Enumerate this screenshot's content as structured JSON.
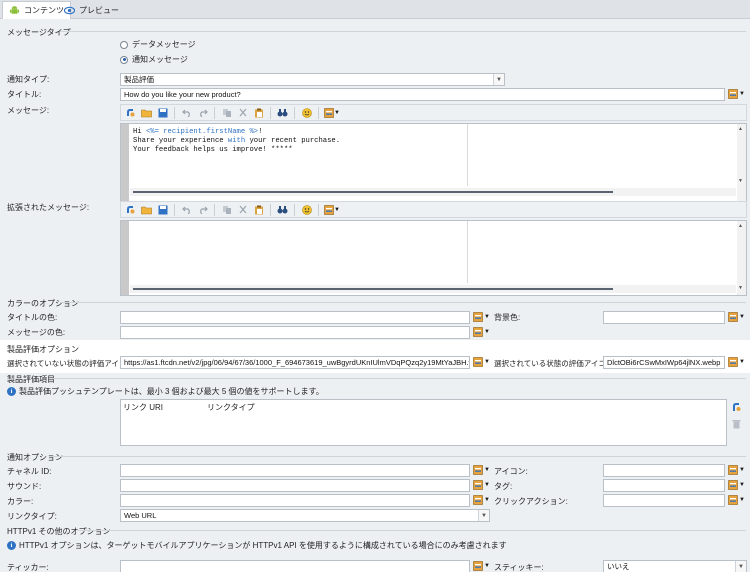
{
  "tabs": [
    {
      "label": "コンテンツ"
    },
    {
      "label": "プレビュー"
    }
  ],
  "message_type": {
    "title": "メッセージタイプ",
    "options": [
      "データメッセージ",
      "通知メッセージ"
    ],
    "selected": 1
  },
  "notification_type": {
    "label": "通知タイプ:",
    "value": "製品評価"
  },
  "title_field": {
    "label": "タイトル:",
    "value": "How do you like your new product?"
  },
  "message": {
    "label": "メッセージ:",
    "line1_pre": "Hi ",
    "line1_tag": "<%= recipient.firstName %>",
    "line1_post": "!",
    "line2_pre": "Share your experience ",
    "line2_kw": "with",
    "line2_post": " your recent purchase.",
    "line3": "Your feedback helps us improve! *****"
  },
  "extended_message": {
    "label": "拡張されたメッセージ:"
  },
  "color_options": {
    "title": "カラーのオプション",
    "title_color": "タイトルの色:",
    "bg_color": "背景色:",
    "message_color": "メッセージの色:"
  },
  "rating_options": {
    "title": "製品評価オプション",
    "unselected_label": "選択されていない状態の評価アイコン:",
    "unselected_value": "https://as1.ftcdn.net/v2/jpg/06/94/67/36/1000_F_694673619_uwBgyrdUKnIUlmVDqPQzq2y19MtYaJBH.webp",
    "selected_label": "選択されている状態の評価アイコン:",
    "selected_value": "DlctOBi6rCSwMxIWp64jlNX.webp"
  },
  "rating_items": {
    "title": "製品評価項目",
    "info": "製品評価プッシュテンプレートは、最小 3 個および最大 5 個の値をサポートします。",
    "columns": [
      "リンク URI",
      "リンクタイプ"
    ]
  },
  "notification_options": {
    "title": "通知オプション",
    "channel_id": "チャネル ID:",
    "icon": "アイコン:",
    "sound": "サウンド:",
    "tag": "タグ:",
    "color": "カラー:",
    "click_action": "クリックアクション:",
    "link_type": "リンクタイプ:",
    "link_type_value": "Web URL"
  },
  "httpv1": {
    "title": "HTTPv1 その他のオプション",
    "info": "HTTPv1 オプションは、ターゲットモバイルアプリケーションが HTTPv1 API を使用するように構成されている場合にのみ考慮されます",
    "ticker": "ティッカー:",
    "sticky": "スティッキー:",
    "sticky_value": "いいえ"
  },
  "colors": {
    "accent": "#2f72c4",
    "highlight": "#ffffff"
  }
}
